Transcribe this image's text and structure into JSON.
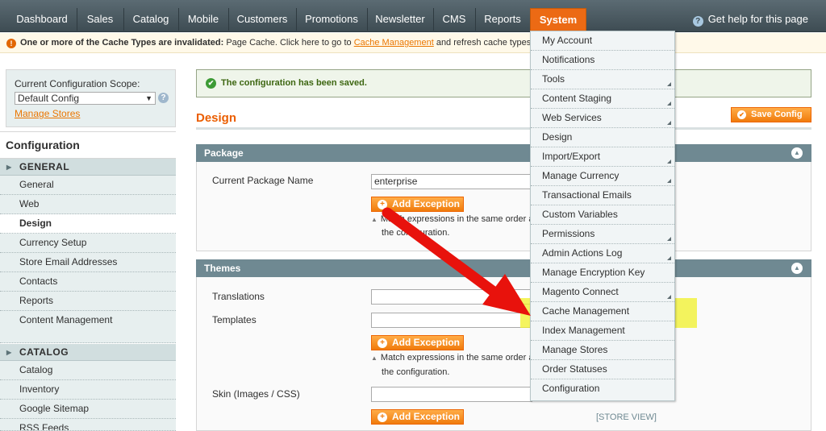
{
  "nav": {
    "items": [
      "Dashboard",
      "Sales",
      "Catalog",
      "Mobile",
      "Customers",
      "Promotions",
      "Newsletter",
      "CMS",
      "Reports",
      "System"
    ],
    "active": "System",
    "help": "Get help for this page"
  },
  "notice": {
    "bold": "One or more of the Cache Types are invalidated:",
    "text": " Page Cache. Click here to go to ",
    "link": "Cache Management",
    "tail": " and refresh cache types."
  },
  "scope": {
    "label": "Current Configuration Scope:",
    "value": "Default Config",
    "manage": "Manage Stores"
  },
  "sidebar": {
    "title": "Configuration",
    "general_header": "GENERAL",
    "general": [
      "General",
      "Web",
      "Design",
      "Currency Setup",
      "Store Email Addresses",
      "Contacts",
      "Reports",
      "Content Management"
    ],
    "active": "Design",
    "catalog_header": "CATALOG",
    "catalog": [
      "Catalog",
      "Inventory",
      "Google Sitemap",
      "RSS Feeds"
    ]
  },
  "main": {
    "success": "The configuration has been saved.",
    "title": "Design",
    "save": "Save Config",
    "package": {
      "header": "Package",
      "label": "Current Package Name",
      "value": "enterprise",
      "add": "Add Exception",
      "note1": "Match expressions in the same order a",
      "note2": "the configuration."
    },
    "themes": {
      "header": "Themes",
      "translations": "Translations",
      "templates": "Templates",
      "add": "Add Exception",
      "note1": "Match expressions in the same order a",
      "note2": "the configuration.",
      "skin": "Skin (Images / CSS)",
      "add2": "Add Exception",
      "scope": "[STORE VIEW]"
    }
  },
  "system_menu": [
    {
      "label": "My Account",
      "sub": false
    },
    {
      "label": "Notifications",
      "sub": false
    },
    {
      "label": "Tools",
      "sub": true
    },
    {
      "label": "Content Staging",
      "sub": true
    },
    {
      "label": "Web Services",
      "sub": true
    },
    {
      "label": "Design",
      "sub": false
    },
    {
      "label": "Import/Export",
      "sub": true
    },
    {
      "label": "Manage Currency",
      "sub": true
    },
    {
      "label": "Transactional Emails",
      "sub": false
    },
    {
      "label": "Custom Variables",
      "sub": false
    },
    {
      "label": "Permissions",
      "sub": true
    },
    {
      "label": "Admin Actions Log",
      "sub": true
    },
    {
      "label": "Manage Encryption Key",
      "sub": false
    },
    {
      "label": "Magento Connect",
      "sub": true
    },
    {
      "label": "Cache Management",
      "sub": false
    },
    {
      "label": "Index Management",
      "sub": false
    },
    {
      "label": "Manage Stores",
      "sub": false
    },
    {
      "label": "Order Statuses",
      "sub": false
    },
    {
      "label": "Configuration",
      "sub": false
    }
  ],
  "colors": {
    "accent": "#ec6a14",
    "arrow": "#e8120c",
    "highlight": "#f0f028"
  }
}
